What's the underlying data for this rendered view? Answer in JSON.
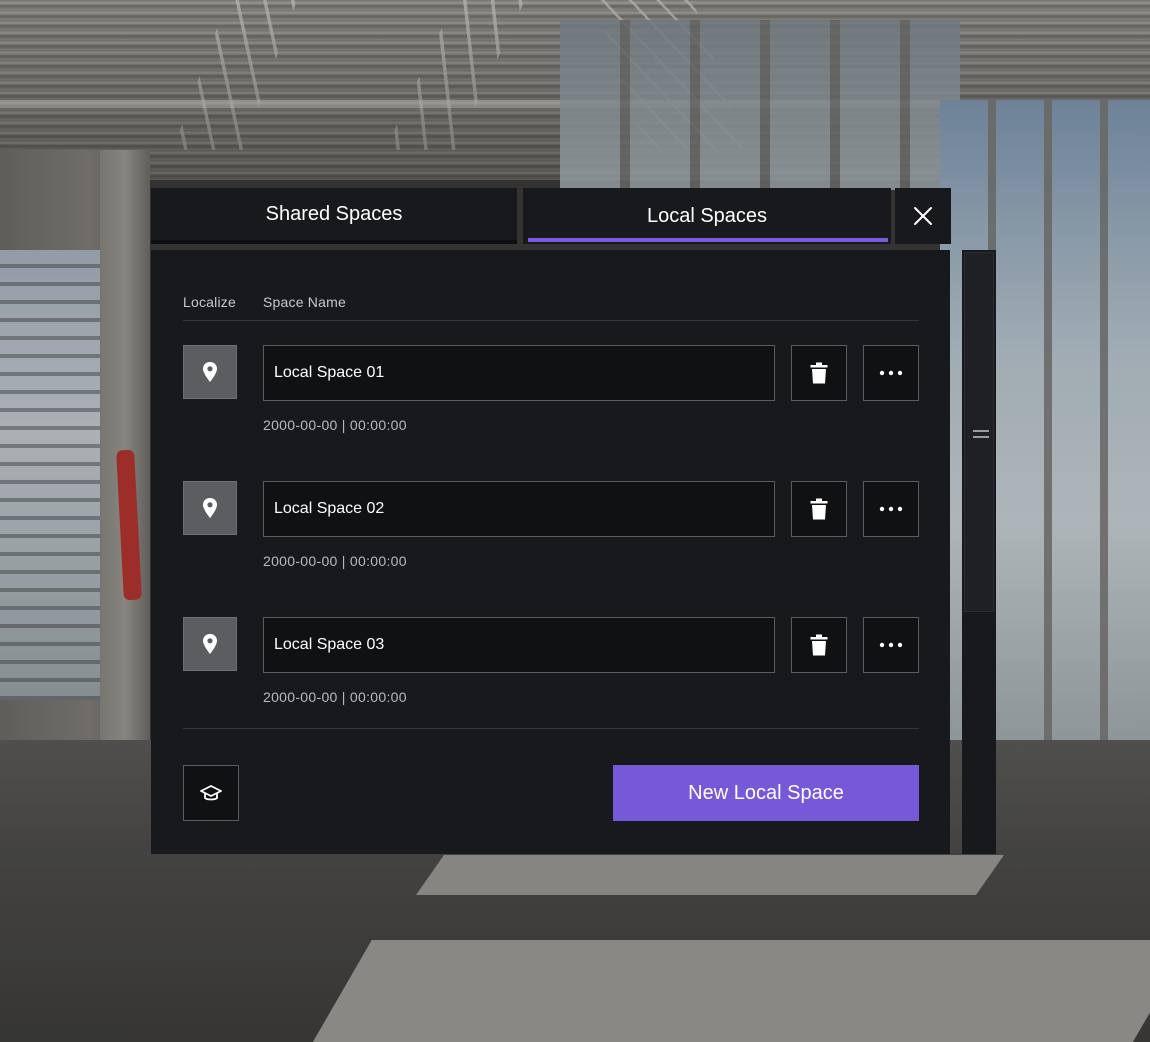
{
  "tabs": [
    {
      "label": "Shared Spaces",
      "active": false
    },
    {
      "label": "Local Spaces",
      "active": true
    }
  ],
  "accent_color": "#7559d9",
  "columns": {
    "localize": "Localize",
    "space_name": "Space Name"
  },
  "spaces": [
    {
      "name": "Local Space 01",
      "timestamp": "2000-00-00 | 00:00:00"
    },
    {
      "name": "Local Space 02",
      "timestamp": "2000-00-00 | 00:00:00"
    },
    {
      "name": "Local Space 03",
      "timestamp": "2000-00-00 | 00:00:00"
    }
  ],
  "icons": {
    "close": "close-icon",
    "localize": "map-pin-icon",
    "delete": "trash-icon",
    "more": "more-horizontal-icon",
    "tutorial": "graduation-cap-icon",
    "scroll_grip": "drag-handle-icon"
  },
  "footer": {
    "new_button_label": "New Local Space"
  }
}
